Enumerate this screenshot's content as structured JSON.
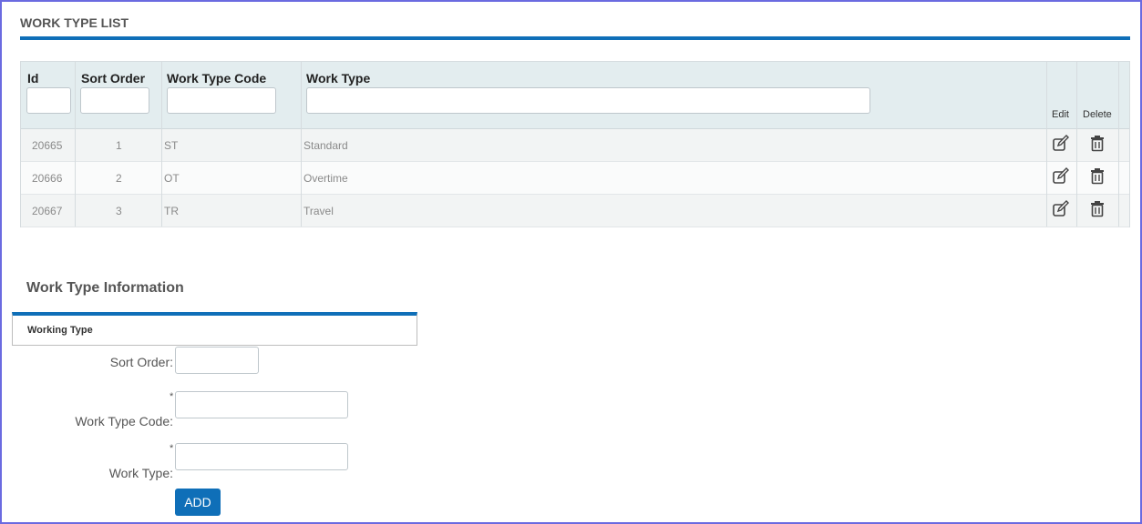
{
  "header": {
    "title": "WORK TYPE LIST"
  },
  "grid": {
    "columns": {
      "id": "Id",
      "sort_order": "Sort Order",
      "work_type_code": "Work Type Code",
      "work_type": "Work Type",
      "edit": "Edit",
      "delete": "Delete"
    },
    "rows": [
      {
        "id": "20665",
        "sort_order": "1",
        "code": "ST",
        "type": "Standard"
      },
      {
        "id": "20666",
        "sort_order": "2",
        "code": "OT",
        "type": "Overtime"
      },
      {
        "id": "20667",
        "sort_order": "3",
        "code": "TR",
        "type": "Travel"
      }
    ],
    "icons": {
      "edit": "edit-icon",
      "delete": "trash-icon"
    }
  },
  "form": {
    "section_title": "Work Type Information",
    "panel_label": "Working Type",
    "sort_order_label": "Sort Order:",
    "work_type_code_label": "Work Type Code:",
    "work_type_label": "Work Type:",
    "required_mark": "*",
    "add_button": "ADD"
  },
  "colors": {
    "accent": "#0f6fb8",
    "header_bg": "#e3edef",
    "frame": "#6a6ae0"
  }
}
